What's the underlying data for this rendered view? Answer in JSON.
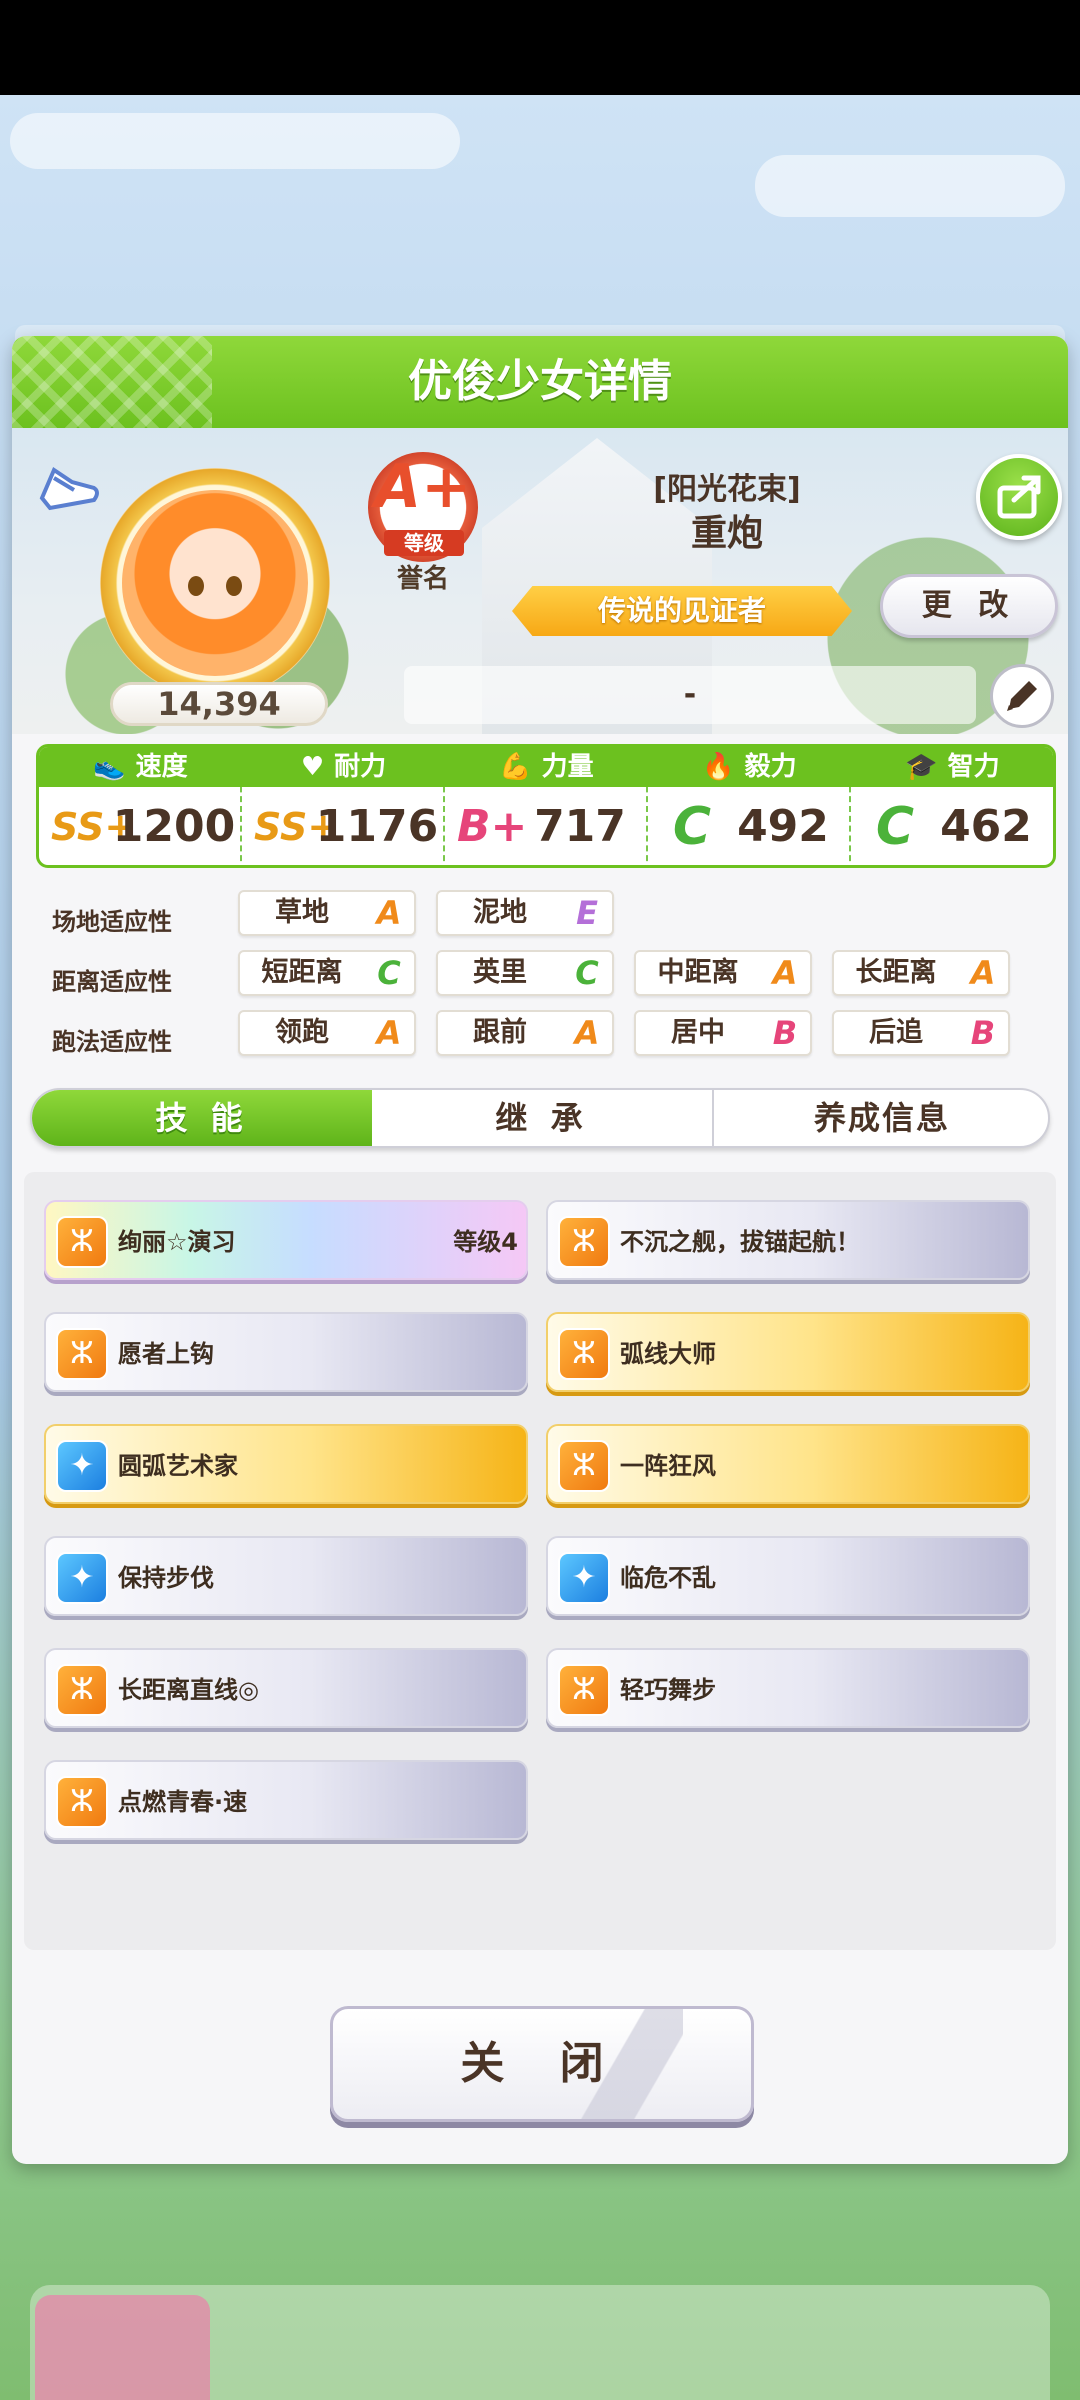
{
  "dialog": {
    "title": "优俊少女详情"
  },
  "profile": {
    "fame": "14,394",
    "rank": {
      "grade": "A+",
      "label": "等级",
      "honor": "誉名"
    },
    "outfit": "[阳光花束]",
    "name": "重炮",
    "title": "传说的见证者",
    "change_label": "更 改",
    "memo": "-"
  },
  "stats": [
    {
      "name": "速度",
      "grade": "SS+",
      "value": "1200",
      "grade_color": "#e89a16"
    },
    {
      "name": "耐力",
      "grade": "SS+",
      "value": "1176",
      "grade_color": "#e89a16"
    },
    {
      "name": "力量",
      "grade": "B+",
      "value": "717",
      "grade_color": "#e6457a"
    },
    {
      "name": "毅力",
      "grade": "C",
      "value": "492",
      "grade_color": "#4bb23a"
    },
    {
      "name": "智力",
      "grade": "C",
      "value": "462",
      "grade_color": "#4bb23a"
    }
  ],
  "aptitude": {
    "track": {
      "label": "场地适应性",
      "items": [
        {
          "name": "草地",
          "grade": "A",
          "color": "#f08a1a"
        },
        {
          "name": "泥地",
          "grade": "E",
          "color": "#b46fd8"
        }
      ]
    },
    "distance": {
      "label": "距离适应性",
      "items": [
        {
          "name": "短距离",
          "grade": "C",
          "color": "#4bb23a"
        },
        {
          "name": "英里",
          "grade": "C",
          "color": "#4bb23a"
        },
        {
          "name": "中距离",
          "grade": "A",
          "color": "#f08a1a"
        },
        {
          "name": "长距离",
          "grade": "A",
          "color": "#f08a1a"
        }
      ]
    },
    "style": {
      "label": "跑法适应性",
      "items": [
        {
          "name": "领跑",
          "grade": "A",
          "color": "#f08a1a"
        },
        {
          "name": "跟前",
          "grade": "A",
          "color": "#f08a1a"
        },
        {
          "name": "居中",
          "grade": "B",
          "color": "#e6457a"
        },
        {
          "name": "后追",
          "grade": "B",
          "color": "#e6457a"
        }
      ]
    }
  },
  "tabs": [
    {
      "label": "技 能",
      "active": true
    },
    {
      "label": "继 承",
      "active": false
    },
    {
      "label": "养成信息",
      "active": false
    }
  ],
  "skills": [
    {
      "name": "绚丽☆演习",
      "level": "等级4",
      "style": "rainbow",
      "icon": "orange-runner-icon"
    },
    {
      "name": "不沉之舰，拔锚起航！",
      "level": "",
      "style": "silver",
      "icon": "orange-runner-icon"
    },
    {
      "name": "愿者上钩",
      "level": "",
      "style": "silver",
      "icon": "orange-runner-icon"
    },
    {
      "name": "弧线大师",
      "level": "",
      "style": "gold",
      "icon": "orange-runner-icon"
    },
    {
      "name": "圆弧艺术家",
      "level": "",
      "style": "gold",
      "icon": "blue-sparkle-icon"
    },
    {
      "name": "一阵狂风",
      "level": "",
      "style": "gold",
      "icon": "orange-runner-icon"
    },
    {
      "name": "保持步伐",
      "level": "",
      "style": "silver",
      "icon": "blue-sparkle-icon"
    },
    {
      "name": "临危不乱",
      "level": "",
      "style": "silver",
      "icon": "blue-sparkle-icon"
    },
    {
      "name": "长距离直线◎",
      "level": "",
      "style": "silver",
      "icon": "orange-runner-icon"
    },
    {
      "name": "轻巧舞步",
      "level": "",
      "style": "silver",
      "icon": "orange-runner-icon"
    },
    {
      "name": "点燃青春·速",
      "level": "",
      "style": "silver",
      "icon": "orange-runner-icon"
    }
  ],
  "close_label": "关 闭"
}
